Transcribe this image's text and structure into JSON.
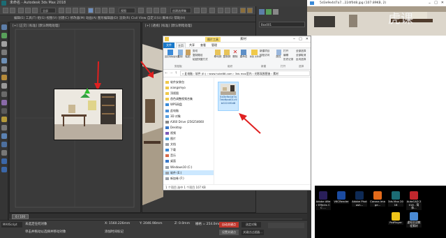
{
  "max": {
    "title": "未命名 - Autodesk 3ds Max 2018",
    "menu": "编辑(E)  工具(T)  组(G)  视图(V)  创建(C)  修改器(M)  动画(A)  图形编辑器(D)  渲染(R)  Civil View  自定义(U)  脚本(S)  帮助(H)",
    "toolbar_dropdown_1": "全部",
    "toolbar_dropdown_2": "视图",
    "toolbar_dropdown_3": "创建选择集",
    "viewport_left_label": "[+] [正交] [标准] [默认明暗处理]",
    "viewport_right_label": "[+] [透视] [标准] [默认明暗处理]",
    "right_panel_label": "Box001",
    "timeline_label": "0 / 100",
    "status_selected": "未选定任何对象",
    "status_hint": "单击并拖动以选择并移动对象",
    "x_label": "X: 1560.226mm",
    "y_label": "Y: 2046.98mm",
    "z_label": "Z: 0.0mm",
    "grid": "栅格 = 254.0mm",
    "autokey": "自动关键点",
    "selected_obj": "选定对象",
    "setkey": "设置关键点",
    "keyfilter": "关键点过滤器...",
    "enter_text": "添加时间标记"
  },
  "explorer": {
    "title": "素材",
    "tabs": [
      "文件",
      "主页",
      "共享",
      "查看",
      "管理"
    ],
    "picture_tools": "图片工具",
    "ribbon": {
      "pin": "固定到快速访问",
      "copy": "复制",
      "paste": "粘贴",
      "cut": "剪切",
      "copy_path": "复制路径",
      "paste_shortcut": "粘贴快捷方式",
      "move_to": "移动到",
      "copy_to": "复制到",
      "delete": "删除",
      "rename": "重命名",
      "new_folder": "新建\n文件夹",
      "new_item": "新建项目",
      "easy_access": "轻松访问",
      "properties": "属性",
      "open": "打开",
      "edit": "编辑",
      "history": "历史记录",
      "select_all": "全部选择",
      "select_none": "全部取消",
      "invert": "反向选择",
      "g_clipboard": "剪贴板",
      "g_organize": "组织",
      "g_new": "新建",
      "g_open": "打开",
      "g_select": "选择"
    },
    "address": "» 此电脑 › 软件 (E:) › www.huke88.com › 3ds max室内 › 光影氛围营造 › 素材",
    "nav": [
      {
        "label": "软件安装包",
        "icon": "folder-icon"
      },
      {
        "label": "xiangsmyo",
        "icon": "folder-icon"
      },
      {
        "label": "顶视图",
        "icon": "folder-icon"
      },
      {
        "label": "首色调整视频合集",
        "icon": "folder-icon"
      },
      {
        "label": "WPS网盘",
        "icon": "cloud-icon"
      },
      {
        "label": "此电脑",
        "icon": "pc-icon"
      },
      {
        "label": "3D 对象",
        "icon": "cube-icon"
      },
      {
        "label": "A360 Drive (256254660",
        "icon": "drive-icon"
      },
      {
        "label": "Desktop",
        "icon": "desktop-icon"
      },
      {
        "label": "视频",
        "icon": "video-icon"
      },
      {
        "label": "图片",
        "icon": "picture-icon"
      },
      {
        "label": "文档",
        "icon": "document-icon"
      },
      {
        "label": "下载",
        "icon": "download-icon"
      },
      {
        "label": "音乐",
        "icon": "music-icon"
      },
      {
        "label": "桌面",
        "icon": "desktop-icon"
      },
      {
        "label": "Windows10 (C:)",
        "icon": "disk-icon"
      },
      {
        "label": "软件 (E:)",
        "icon": "disk-icon"
      },
      {
        "label": "新加卷 (F:)",
        "icon": "disk-icon"
      }
    ],
    "file_name": "5d3e9e4d7a7ebfbad01c9b0224f0d8",
    "status": "1 个项目   选中 1 个项目  107 KB"
  },
  "photo_viewer": {
    "title": "5d3e9e4d7a7...224f0d8.jpg (107.89KB, 2)"
  },
  "desktop": {
    "icons": [
      {
        "label": "Adobe After Effects CC ...",
        "color": "#2a1f5a",
        "icon": "after-effects-icon"
      },
      {
        "label": "V6СRender",
        "color": "#1b4ba0",
        "icon": "render-icon"
      },
      {
        "label": "Adobe Photosh...",
        "color": "#0e2a55",
        "icon": "photoshop-icon"
      },
      {
        "label": "Corona Image...",
        "color": "#e36a1a",
        "icon": "corona-icon"
      },
      {
        "label": "3ds Max 2018",
        "color": "#1c6c74",
        "icon": "3dsmax-icon"
      },
      {
        "label": "AutoCAD 2018 - 简体...",
        "color": "#c0272d",
        "icon": "autocad-icon"
      },
      {
        "label": "PotPlayer",
        "color": "#f0c419",
        "icon": "potplayer-icon"
      },
      {
        "label": "虚拟实战教程素材",
        "color": "#4a8ad4",
        "icon": "folder-icon"
      }
    ]
  },
  "watermark": "虎课"
}
